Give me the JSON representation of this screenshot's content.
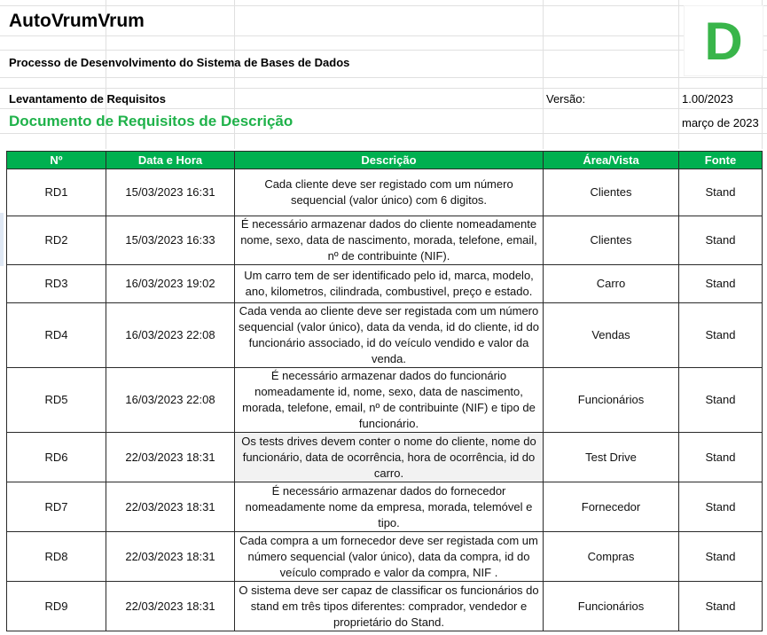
{
  "header": {
    "title": "AutoVrumVrum",
    "subtitle": "Processo de Desenvolvimento do Sistema de Bases de Dados",
    "section": "Levantamento de Requisitos",
    "version_label": "Versão:",
    "version_value": "1.00/2023",
    "doc_title": "Documento de Requisitos de Descrição",
    "date": "março de 2023",
    "logo_letter": "D",
    "accent_color": "#00b050",
    "title_green": "#1fb24a"
  },
  "table": {
    "columns": [
      "Nº",
      "Data e Hora",
      "Descrição",
      "Área/Vista",
      "Fonte"
    ],
    "rows": [
      {
        "n": "RD1",
        "dt": "15/03/2023 16:31",
        "desc": "Cada cliente deve ser registado com um número sequencial (valor único) com 6 digitos.",
        "area": "Clientes",
        "fonte": "Stand"
      },
      {
        "n": "RD2",
        "dt": "15/03/2023 16:33",
        "desc": "É necessário armazenar dados do cliente nomeadamente nome, sexo, data de nascimento, morada, telefone, email, nº de contribuinte (NIF).",
        "area": "Clientes",
        "fonte": "Stand"
      },
      {
        "n": "RD3",
        "dt": "16/03/2023 19:02",
        "desc": "Um carro tem de ser identificado pelo id, marca, modelo, ano, kilometros, cilindrada, combustivel, preço e estado.",
        "area": "Carro",
        "fonte": "Stand"
      },
      {
        "n": "RD4",
        "dt": "16/03/2023 22:08",
        "desc": "Cada venda ao cliente deve ser registada com um número sequencial (valor único), data da venda, id do cliente, id do funcionário associado, id do veículo vendido e valor da venda.",
        "area": "Vendas",
        "fonte": "Stand"
      },
      {
        "n": "RD5",
        "dt": "16/03/2023 22:08",
        "desc": "É necessário armazenar dados do funcionário nomeadamente id, nome, sexo, data de nascimento, morada, telefone, email, nº de contribuinte (NIF) e tipo de funcionário.",
        "area": "Funcionários",
        "fonte": "Stand"
      },
      {
        "n": "RD6",
        "dt": "22/03/2023 18:31",
        "desc": "Os tests drives devem conter o nome do cliente, nome do funcionário, data de ocorrência, hora de ocorrência, id do carro.",
        "area": "Test Drive",
        "fonte": "Stand"
      },
      {
        "n": "RD7",
        "dt": "22/03/2023 18:31",
        "desc": "É necessário armazenar dados do fornecedor nomeadamente nome da empresa, morada, telemóvel e tipo.",
        "area": "Fornecedor",
        "fonte": "Stand"
      },
      {
        "n": "RD8",
        "dt": "22/03/2023 18:31",
        "desc": "Cada compra a um fornecedor deve ser registada com um número sequencial (valor único), data da compra, id do veículo comprado e valor da compra, NIF .",
        "area": "Compras",
        "fonte": "Stand"
      },
      {
        "n": "RD9",
        "dt": "22/03/2023 18:31",
        "desc": "O sistema deve ser capaz de classificar os funcionários do stand em três tipos diferentes: comprador, vendedor e proprietário do Stand.",
        "area": "Funcionários",
        "fonte": "Stand"
      }
    ]
  }
}
